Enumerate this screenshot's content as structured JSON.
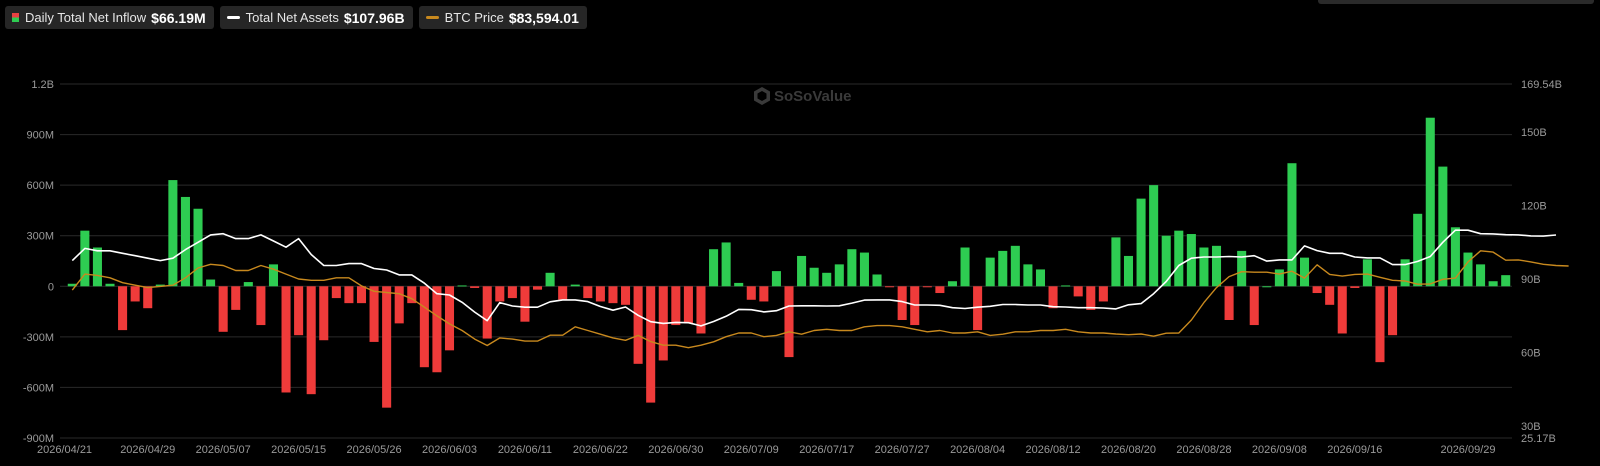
{
  "legend": {
    "inflow": {
      "label": "Daily Total Net Inflow",
      "value": "$66.19M"
    },
    "assets": {
      "label": "Total Net Assets",
      "value": "$107.96B"
    },
    "btc": {
      "label": "BTC Price",
      "value": "$83,594.01"
    }
  },
  "watermark": "SoSoValue",
  "colors": {
    "positive": "#2ecc52",
    "negative": "#ef3b3a",
    "assets_line": "#ffffff",
    "btc_line": "#c8891e",
    "grid": "#2a2a2a"
  },
  "chart_data": {
    "type": "bar",
    "left_axis": {
      "ticks": [
        "-900M",
        "-600M",
        "-300M",
        "0",
        "300M",
        "600M",
        "900M",
        "1.2B"
      ],
      "tick_values": [
        -900,
        -600,
        -300,
        0,
        300,
        600,
        900,
        1200
      ],
      "ylim": [
        -900,
        1200
      ],
      "unit": "M"
    },
    "right_axis": {
      "ticks": [
        "25.17B",
        "30B",
        "60B",
        "90B",
        "120B",
        "150B",
        "169.54B"
      ],
      "tick_values": [
        25.17,
        30,
        60,
        90,
        120,
        150,
        169.54
      ],
      "ylim": [
        25.17,
        169.54
      ],
      "unit": "B"
    },
    "x_ticks": [
      {
        "label": "2026/04/21",
        "index": 0
      },
      {
        "label": "2026/04/29",
        "index": 6
      },
      {
        "label": "2026/05/07",
        "index": 12
      },
      {
        "label": "2026/05/15",
        "index": 18
      },
      {
        "label": "2026/05/26",
        "index": 24
      },
      {
        "label": "2026/06/03",
        "index": 30
      },
      {
        "label": "2026/06/11",
        "index": 36
      },
      {
        "label": "2026/06/22",
        "index": 42
      },
      {
        "label": "2026/06/30",
        "index": 48
      },
      {
        "label": "2026/07/09",
        "index": 54
      },
      {
        "label": "2026/07/17",
        "index": 60
      },
      {
        "label": "2026/07/27",
        "index": 66
      },
      {
        "label": "2026/08/04",
        "index": 72
      },
      {
        "label": "2026/08/12",
        "index": 78
      },
      {
        "label": "2026/08/20",
        "index": 84
      },
      {
        "label": "2026/08/28",
        "index": 90
      },
      {
        "label": "2026/09/08",
        "index": 96
      },
      {
        "label": "2026/09/16",
        "index": 102
      },
      {
        "label": "2026/09/29",
        "index": 111
      }
    ],
    "grid": true,
    "legend_position": "top-left",
    "series": [
      {
        "name": "Daily Total Net Inflow",
        "type": "bar",
        "values": [
          15,
          330,
          230,
          15,
          -260,
          -90,
          -130,
          10,
          630,
          530,
          460,
          40,
          -270,
          -140,
          25,
          -230,
          130,
          -630,
          -290,
          -640,
          -320,
          -70,
          -100,
          -100,
          -330,
          -720,
          -220,
          -100,
          -480,
          -510,
          -380,
          5,
          -10,
          -310,
          -90,
          -70,
          -210,
          -20,
          80,
          -80,
          10,
          -70,
          -90,
          -100,
          -110,
          -460,
          -690,
          -440,
          -230,
          -220,
          -280,
          220,
          260,
          20,
          -80,
          -90,
          90,
          -420,
          180,
          110,
          80,
          130,
          220,
          200,
          70,
          -5,
          -200,
          -230,
          -5,
          -40,
          30,
          230,
          -260,
          170,
          210,
          240,
          130,
          100,
          -130,
          5,
          -60,
          -140,
          -90,
          290,
          180,
          520,
          600,
          300,
          330,
          310,
          230,
          240,
          -200,
          210,
          -230,
          0,
          100,
          730,
          170,
          -40,
          -110,
          -280,
          -10,
          160,
          -450,
          -290,
          160,
          430,
          1000,
          710,
          350,
          200,
          130,
          30,
          66
        ],
        "colors": "sign"
      },
      {
        "name": "Total Net Assets",
        "type": "line",
        "axis": "right",
        "values": [
          97.5,
          102.5,
          101.5,
          101.5,
          100.5,
          99.5,
          98.5,
          97.5,
          98.5,
          102,
          105,
          108,
          108.5,
          106.5,
          106.5,
          108,
          105.5,
          103,
          106.5,
          100,
          95.5,
          95.5,
          96.3,
          96.3,
          94.3,
          93.7,
          91.7,
          91.7,
          88.3,
          84,
          83.5,
          80.5,
          76.5,
          73,
          80.4,
          79,
          78.5,
          78.5,
          80.7,
          81.5,
          81.5,
          80.8,
          78.8,
          77.3,
          78.6,
          75.2,
          72.6,
          71.9,
          72.3,
          72.2,
          70.9,
          72.7,
          74.8,
          77.6,
          77.5,
          76.6,
          77.1,
          79,
          79.1,
          79.1,
          79,
          79.1,
          80.2,
          81.4,
          81.5,
          81.5,
          80.8,
          79.4,
          79.4,
          79.3,
          78.3,
          78,
          78.5,
          78.9,
          79.6,
          79.6,
          79.4,
          79.4,
          78.7,
          78.6,
          78.3,
          78.3,
          78.2,
          77.8,
          79.5,
          80,
          84,
          89,
          95.5,
          98.5,
          99,
          99,
          99.2,
          99,
          99.5,
          97.3,
          97.8,
          97.8,
          103.5,
          101.6,
          100.5,
          100.5,
          99,
          98.6,
          98.6,
          95.9,
          95.9,
          97.2,
          99.2,
          105,
          109.9,
          109.9,
          108.5,
          108.4,
          108.1,
          108,
          107.6,
          107.5,
          107.96
        ]
      },
      {
        "name": "BTC Price",
        "type": "line",
        "axis": "right",
        "values": [
          85.5,
          92,
          91.5,
          90.5,
          88.5,
          87.5,
          86.5,
          87,
          87.5,
          90.5,
          94.5,
          96,
          95.5,
          93.5,
          93.5,
          95.5,
          94,
          92,
          90,
          89.5,
          89.5,
          90.5,
          90.5,
          87.2,
          85,
          84.5,
          84,
          82,
          78.5,
          75,
          71.7,
          69,
          65.5,
          62.9,
          66,
          65.5,
          64.7,
          64.7,
          67.1,
          67.1,
          70.5,
          69,
          67.5,
          66,
          65,
          67,
          64.5,
          63,
          63,
          62,
          63,
          64.4,
          66.5,
          68,
          68,
          66.5,
          67,
          68.5,
          67.5,
          69,
          69.5,
          69,
          69,
          70.5,
          71,
          71,
          70.5,
          69.5,
          68.5,
          69,
          68,
          68,
          68.5,
          67,
          67.5,
          68.5,
          68.5,
          69,
          69,
          69.5,
          68.5,
          68,
          68,
          67.6,
          67.3,
          67.6,
          66.7,
          67.9,
          68,
          73.3,
          80.4,
          86.5,
          91,
          93,
          92.8,
          92.8,
          92,
          93.2,
          90.4,
          95.8,
          91.9,
          91.2,
          91.9,
          92,
          90.7,
          89.5,
          89.2,
          87.9,
          88,
          89.9,
          90.4,
          97,
          101.5,
          101,
          97.7,
          97.8,
          97,
          96,
          95.5,
          95.3
        ]
      }
    ]
  }
}
